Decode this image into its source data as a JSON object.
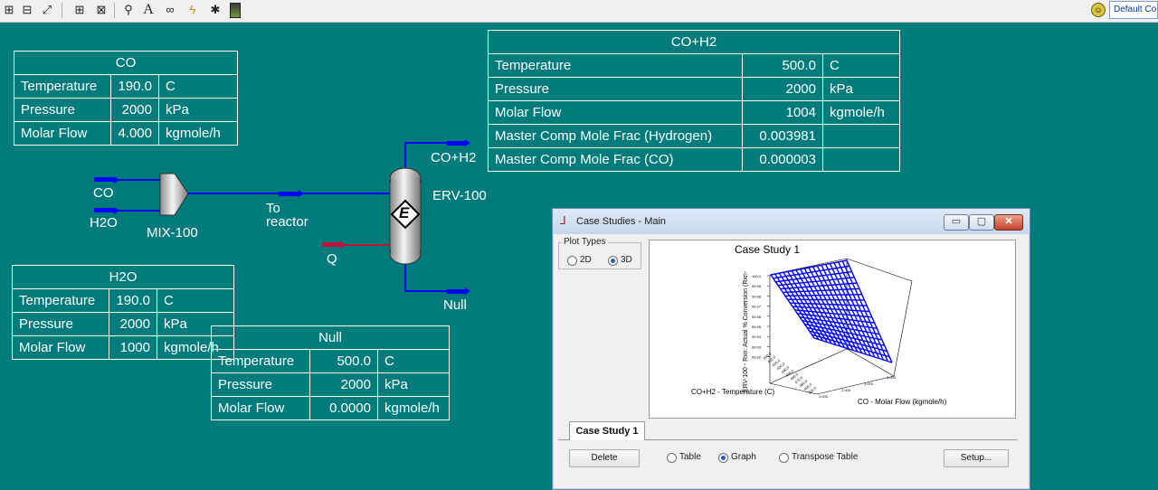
{
  "toolbar": {
    "icons": [
      "object-navigator-icon",
      "object-palette-icon",
      "size-icon",
      "sum-icon",
      "marker-icon",
      "zoom-icon",
      "text-icon",
      "binoculars-icon",
      "lightning-icon",
      "wrench-icon",
      "color-icon"
    ],
    "preset_label": "Default Co"
  },
  "streams": {
    "co": {
      "name": "CO",
      "rows": [
        {
          "label": "Temperature",
          "value": "190.0",
          "unit": "C"
        },
        {
          "label": "Pressure",
          "value": "2000",
          "unit": "kPa"
        },
        {
          "label": "Molar Flow",
          "value": "4.000",
          "unit": "kgmole/h"
        }
      ]
    },
    "h2o": {
      "name": "H2O",
      "rows": [
        {
          "label": "Temperature",
          "value": "190.0",
          "unit": "C"
        },
        {
          "label": "Pressure",
          "value": "2000",
          "unit": "kPa"
        },
        {
          "label": "Molar Flow",
          "value": "1000",
          "unit": "kgmole/h"
        }
      ]
    },
    "null": {
      "name": "Null",
      "rows": [
        {
          "label": "Temperature",
          "value": "500.0",
          "unit": "C"
        },
        {
          "label": "Pressure",
          "value": "2000",
          "unit": "kPa"
        },
        {
          "label": "Molar Flow",
          "value": "0.0000",
          "unit": "kgmole/h"
        }
      ]
    },
    "coh2": {
      "name": "CO+H2",
      "rows": [
        {
          "label": "Temperature",
          "value": "500.0",
          "unit": "C"
        },
        {
          "label": "Pressure",
          "value": "2000",
          "unit": "kPa"
        },
        {
          "label": "Molar Flow",
          "value": "1004",
          "unit": "kgmole/h"
        },
        {
          "label": "Master Comp Mole Frac (Hydrogen)",
          "value": "0.003981",
          "unit": ""
        },
        {
          "label": "Master Comp Mole Frac (CO)",
          "value": "0.000003",
          "unit": ""
        }
      ]
    }
  },
  "pfd": {
    "co_label": "CO",
    "h2o_label": "H2O",
    "mixer_label": "MIX-100",
    "to_reactor_1": "To",
    "to_reactor_2": "reactor",
    "q_label": "Q",
    "reactor_label": "ERV-100",
    "reactor_glyph": "E",
    "top_product_label": "CO+H2",
    "bottom_product_label": "Null",
    "colors": {
      "material": "#0000ff",
      "energy": "#c0103c",
      "background": "#007b7b"
    }
  },
  "dialog": {
    "title": "Case Studies - Main",
    "plot_types_label": "Plot Types",
    "option_2d": "2D",
    "option_3d": "3D",
    "selected_plot_type": "3D",
    "plot": {
      "title": "Case Study 1",
      "z_axis_label": "ERV-100 - Rxn: Actual % Conversion (Rxn-",
      "x_axis_label": "CO+H2 - Temperature (C)",
      "y_axis_label": "CO - Molar Flow (kgmole/h)",
      "z_ticks": [
        "100.0",
        "99.99",
        "99.98",
        "99.97",
        "99.96",
        "99.95",
        "99.94",
        "99.93",
        "99.92"
      ],
      "y_ticks": [
        "1.000",
        "2.000",
        "3.000",
        "4.000"
      ],
      "x_ticks": [
        "400.0",
        "410.0",
        "420.0",
        "430.0",
        "440.0",
        "450.0",
        "460.0",
        "470.0",
        "480.0",
        "490.0",
        "500.0"
      ],
      "surface_color": "#0000ff"
    },
    "tab_label": "Case Study 1",
    "delete_label": "Delete",
    "view_table": "Table",
    "view_graph": "Graph",
    "view_transpose": "Transpose Table",
    "selected_view": "Graph",
    "setup_label": "Setup..."
  }
}
